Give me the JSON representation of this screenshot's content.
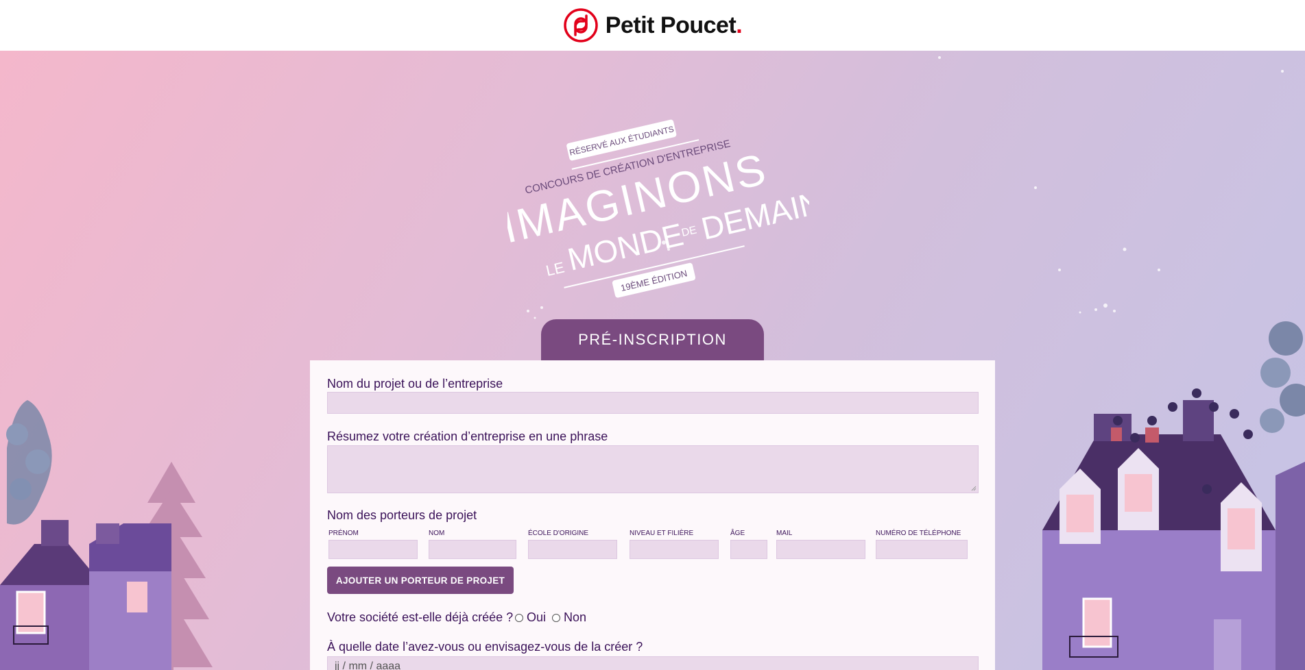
{
  "header": {
    "brand_name": "Petit Poucet",
    "brand_dot": ".",
    "brand_color": "#e2001a"
  },
  "emblem": {
    "ribbon_top": "RÉSERVÉ AUX ÉTUDIANTS",
    "subtitle": "CONCOURS DE CRÉATION D'ENTREPRISE",
    "title_line1": "IMAGINONS",
    "title_le": "LE",
    "title_monde": "MONDE",
    "title_de": "DE",
    "title_demain": "DEMAIN",
    "edition": "19ÈME ÉDITION"
  },
  "form": {
    "tab_title": "PRÉ-INSCRIPTION",
    "project_name_label": "Nom du projet ou de l’entreprise",
    "summary_label": "Résumez votre création d’entreprise en une phrase",
    "holders_label": "Nom des porteurs de projet",
    "columns": {
      "firstname": "Prénom",
      "lastname": "Nom",
      "school": "École d'origine",
      "level": "Niveau et filière",
      "age": "Âge",
      "mail": "Mail",
      "phone": "Numéro de téléphone"
    },
    "add_holder_button": "AJOUTER UN PORTEUR DE PROJET",
    "company_created_question": "Votre société est-elle déjà créée ?",
    "option_yes": "Oui",
    "option_no": "Non",
    "date_question": "À quelle date l’avez-vous ou envisagez-vous de la créer ?",
    "date_placeholder": "jj / mm / aaaa"
  },
  "colors": {
    "accent": "#7a4a80",
    "label": "#3a1158",
    "field_bg": "#ead9ea"
  }
}
